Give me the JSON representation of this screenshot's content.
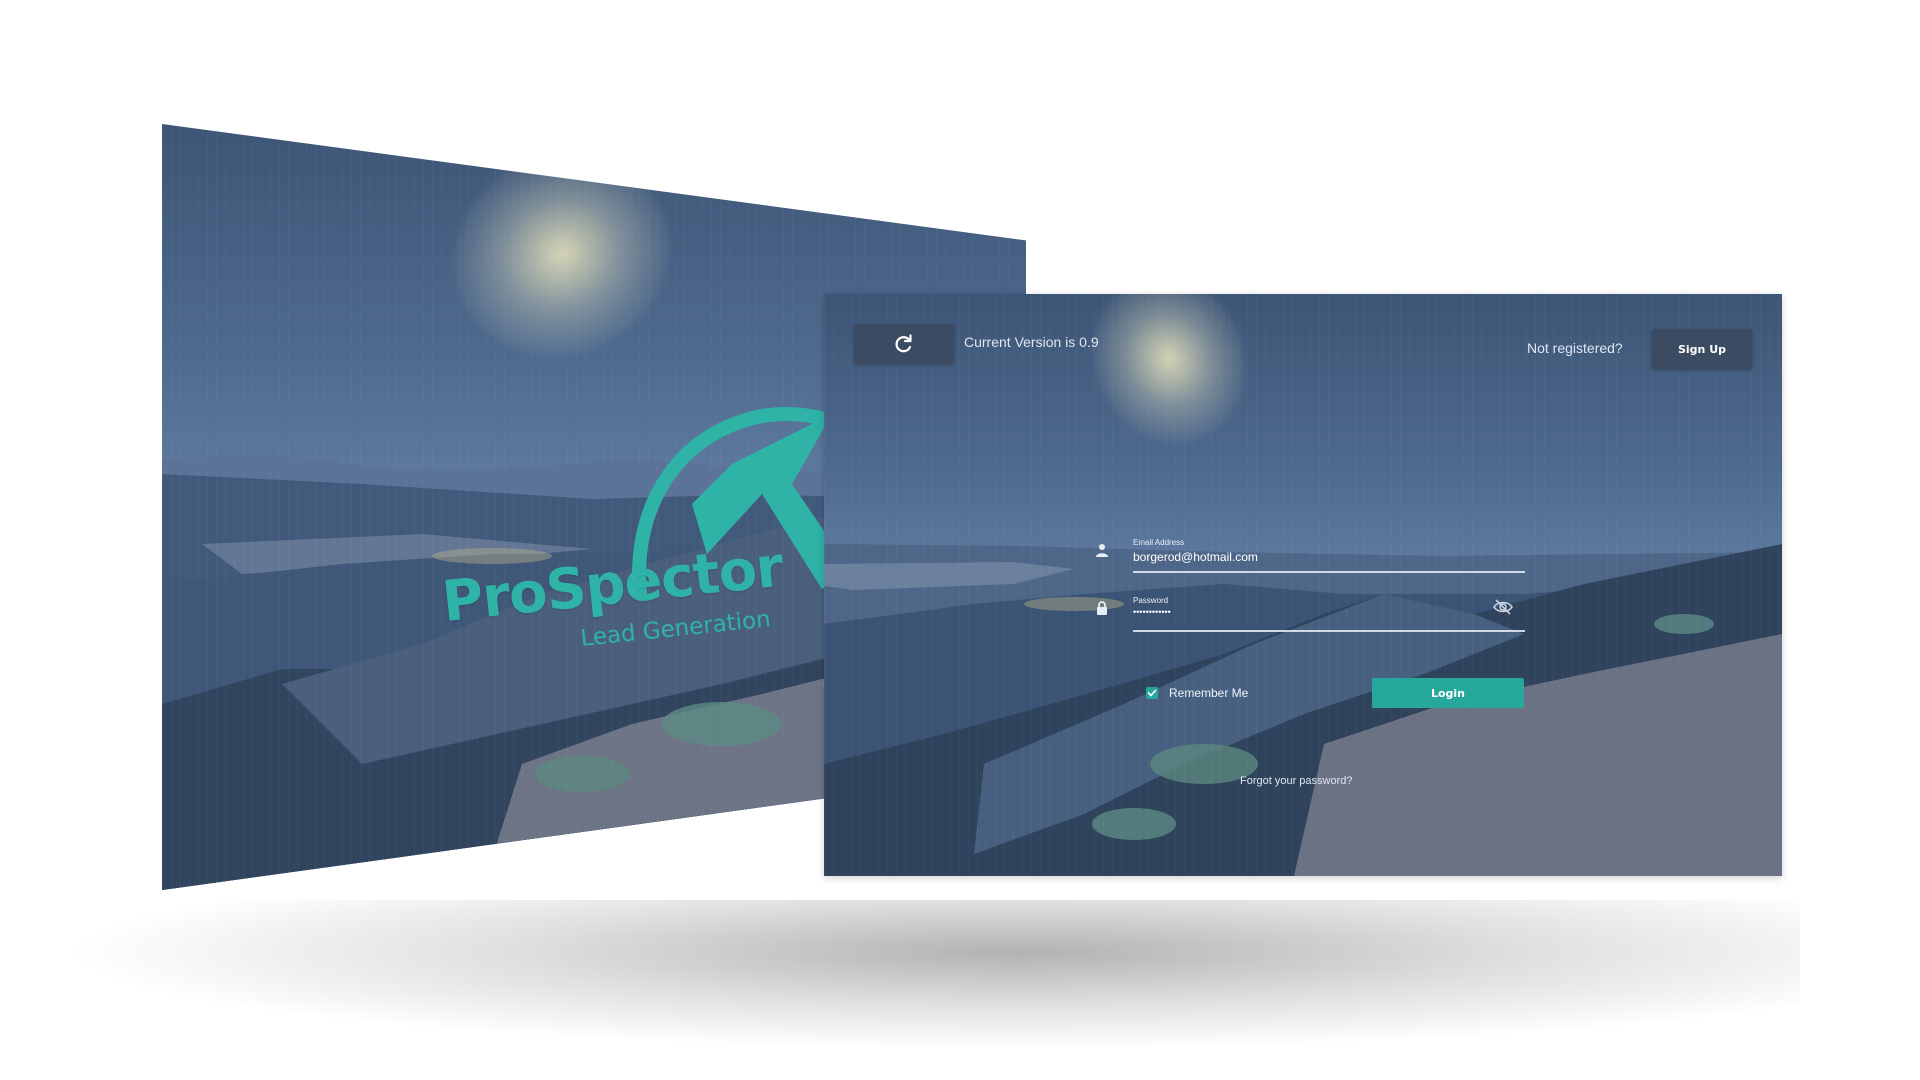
{
  "left_screen": {
    "logo": {
      "title": "ProSpector",
      "subtitle": "Lead Generation",
      "brand_color": "#2fb3a7",
      "icon": "pickaxe-logo-icon"
    }
  },
  "login_screen": {
    "header": {
      "refresh_icon": "refresh-icon",
      "version_text": "Current Version is 0.9",
      "not_registered_text": "Not registered?",
      "signup_label": "Sign Up"
    },
    "form": {
      "email_label": "Email Address",
      "email_value": "borgerod@hotmail.com",
      "password_label": "Password",
      "password_value": "••••••••••••",
      "remember_label": "Remember Me",
      "remember_checked": true,
      "login_label": "Login",
      "forgot_label": "Forgot your password?"
    },
    "colors": {
      "accent": "#27a89c",
      "button_dark": "#3b4b62"
    }
  }
}
